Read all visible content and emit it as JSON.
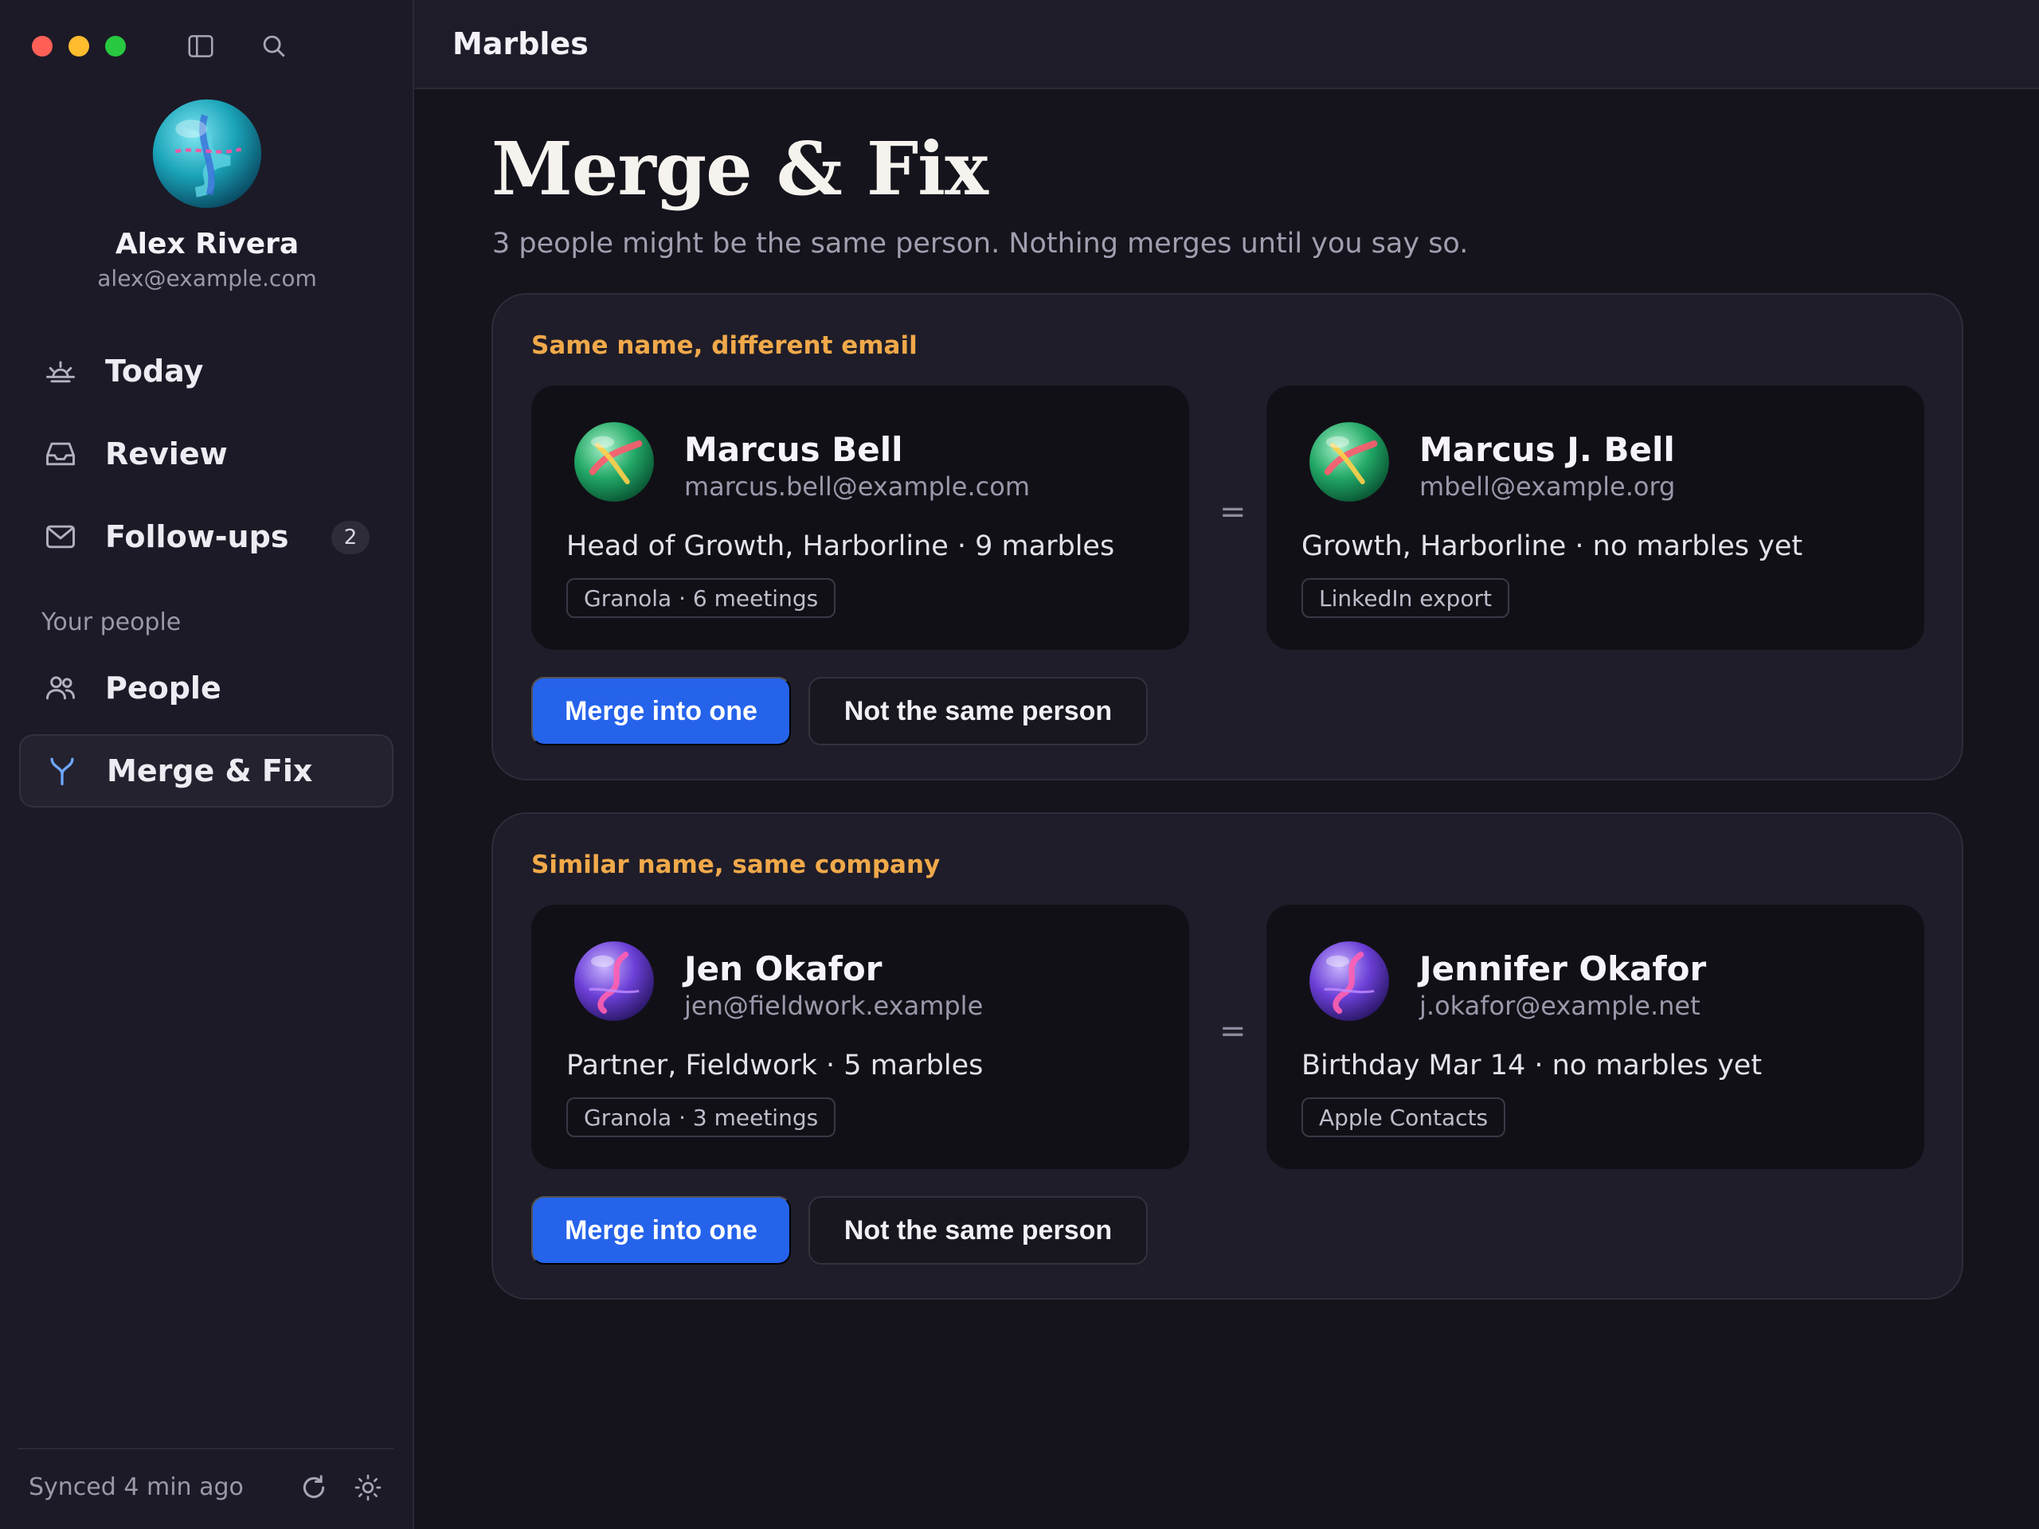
{
  "app": {
    "title": "Marbles"
  },
  "sidebar": {
    "user": {
      "name": "Alex Rivera",
      "email": "alex@example.com"
    },
    "nav": [
      {
        "label": "Today",
        "icon": "sunrise-icon"
      },
      {
        "label": "Review",
        "icon": "inbox-icon"
      },
      {
        "label": "Follow-ups",
        "icon": "mail-icon",
        "badge": "2"
      }
    ],
    "section_label": "Your people",
    "people_nav": [
      {
        "label": "People",
        "icon": "people-icon"
      },
      {
        "label": "Merge & Fix",
        "icon": "merge-icon",
        "active": true
      }
    ],
    "footer": {
      "sync_status": "Synced 4 min ago"
    }
  },
  "page": {
    "title": "Merge & Fix",
    "subtitle": "3 people might be the same person. Nothing merges until you say so."
  },
  "groups": [
    {
      "reason": "Same name, different email",
      "left": {
        "name": "Marcus Bell",
        "email": "marcus.bell@example.com",
        "description": "Head of Growth, Harborline · 9 marbles",
        "source": "Granola · 6 meetings"
      },
      "equals": "=",
      "right": {
        "name": "Marcus J. Bell",
        "email": "mbell@example.org",
        "description": "Growth, Harborline · no marbles yet",
        "source": "LinkedIn export"
      },
      "merge_label": "Merge into one",
      "reject_label": "Not the same person"
    },
    {
      "reason": "Similar name, same company",
      "left": {
        "name": "Jen Okafor",
        "email": "jen@fieldwork.example",
        "description": "Partner, Fieldwork · 5 marbles",
        "source": "Granola · 3 meetings"
      },
      "equals": "=",
      "right": {
        "name": "Jennifer Okafor",
        "email": "j.okafor@example.net",
        "description": "Birthday Mar 14 · no marbles yet",
        "source": "Apple Contacts"
      },
      "merge_label": "Merge into one",
      "reject_label": "Not the same person"
    }
  ],
  "colors": {
    "accent": "#2563eb",
    "reason_label": "#f0a94a",
    "active_nav_icon": "#6ea8ff"
  }
}
